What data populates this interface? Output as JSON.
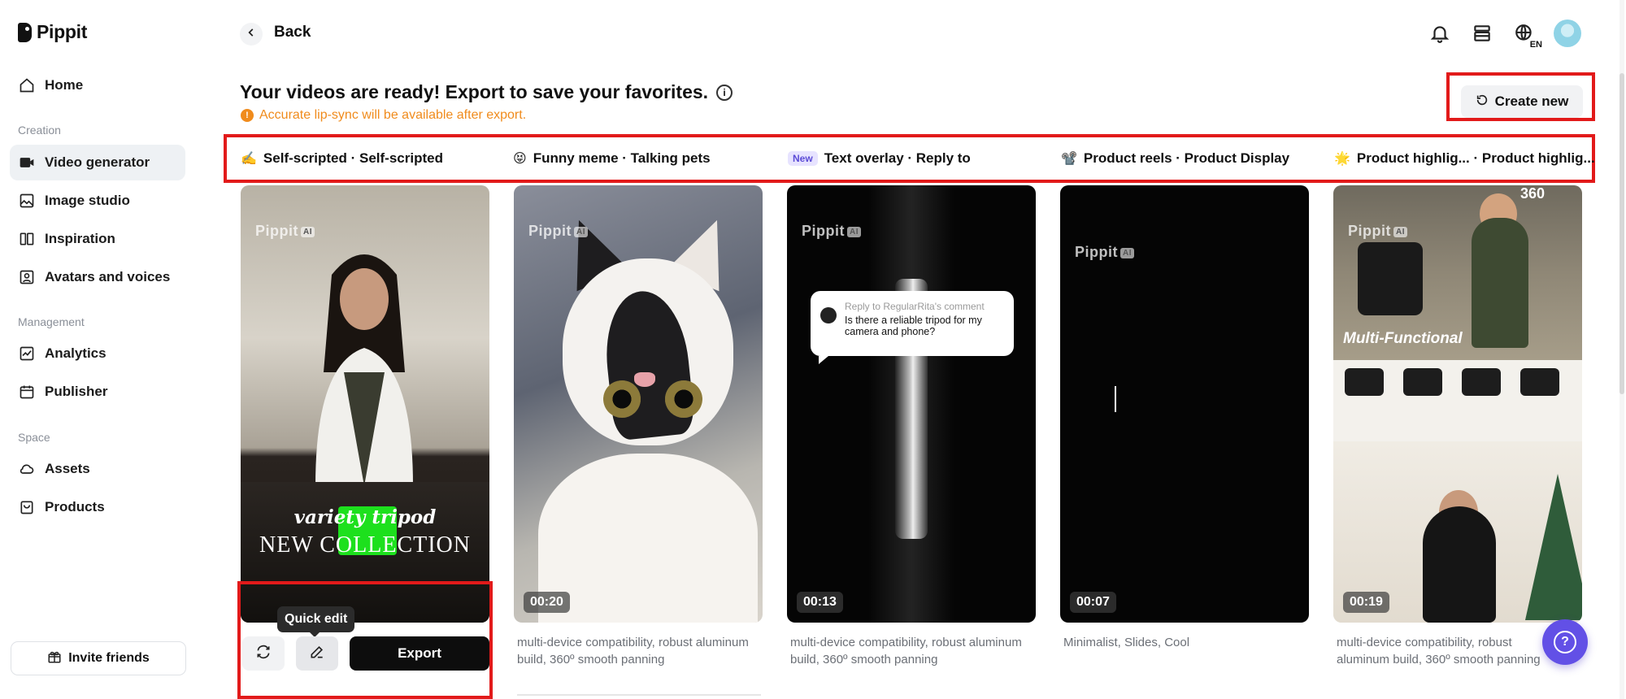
{
  "app": {
    "name": "Pippit"
  },
  "sidebar": {
    "items": [
      {
        "label": "Home",
        "icon": "home-icon"
      },
      {
        "section": "Creation"
      },
      {
        "label": "Video generator",
        "icon": "video-generator-icon",
        "active": true
      },
      {
        "label": "Image studio",
        "icon": "image-studio-icon"
      },
      {
        "label": "Inspiration",
        "icon": "inspiration-icon"
      },
      {
        "label": "Avatars and voices",
        "icon": "avatar-icon"
      },
      {
        "section": "Management"
      },
      {
        "label": "Analytics",
        "icon": "analytics-icon"
      },
      {
        "label": "Publisher",
        "icon": "calendar-icon"
      },
      {
        "section": "Space"
      },
      {
        "label": "Assets",
        "icon": "cloud-icon"
      },
      {
        "label": "Products",
        "icon": "bag-icon"
      }
    ],
    "sections": {
      "creation": "Creation",
      "management": "Management",
      "space": "Space"
    },
    "labels": {
      "home": "Home",
      "video_generator": "Video generator",
      "image_studio": "Image studio",
      "inspiration": "Inspiration",
      "avatars": "Avatars and voices",
      "analytics": "Analytics",
      "publisher": "Publisher",
      "assets": "Assets",
      "products": "Products"
    },
    "invite_label": "Invite friends"
  },
  "header": {
    "back_label": "Back",
    "language": "EN",
    "icons": [
      "bell-icon",
      "billing-icon",
      "globe-icon"
    ]
  },
  "main": {
    "headline": "Your videos are ready! Export to save your favorites.",
    "warning": "Accurate lip-sync will be available after export.",
    "create_new_label": "Create new",
    "tabs": [
      {
        "emoji": "✍️",
        "label": "Self-scripted · Self-scripted"
      },
      {
        "emoji": "😝",
        "label": "Funny meme · Talking pets"
      },
      {
        "badge": "New",
        "label": "Text overlay · Reply to"
      },
      {
        "emoji": "📽️",
        "label": "Product reels · Product Display"
      },
      {
        "emoji": "🌟",
        "label": "Product highlig... · Product highlig..."
      }
    ],
    "cards": [
      {
        "watermark": "Pippit",
        "overlay_line1": "variety tripod",
        "overlay_line2": "NEW COLLECTION",
        "tooltip": "Quick edit",
        "export_label": "Export"
      },
      {
        "watermark": "Pippit",
        "duration": "00:20",
        "description": "multi-device compatibility, robust aluminum build, 360º smooth panning"
      },
      {
        "watermark": "Pippit",
        "duration": "00:13",
        "comment_reply": "Reply to RegularRita's comment",
        "comment_text": "Is there a reliable tripod for my camera and phone?",
        "description": "multi-device compatibility, robust aluminum build, 360º smooth panning"
      },
      {
        "watermark": "Pippit",
        "duration": "00:07",
        "description": "Minimalist, Slides, Cool"
      },
      {
        "watermark": "Pippit",
        "duration": "00:19",
        "title_overlay": "Multi-Functional",
        "overlay_360": "360",
        "description": "multi-device compatibility, robust aluminum build, 360º smooth panning"
      }
    ],
    "watermark_badge": "AI"
  },
  "colors": {
    "accent": "#6250e6",
    "warning": "#f08b1c",
    "highlight_box": "#e21a1a",
    "active_nav": "#eef1f4"
  }
}
